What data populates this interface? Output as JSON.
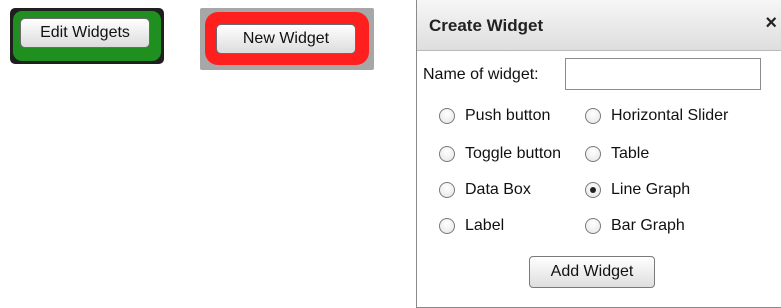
{
  "edit_widgets": {
    "label": "Edit Widgets",
    "frame_color": "#1f8f1f"
  },
  "new_widget": {
    "label": "New Widget",
    "frame_color": "#ff1f1f"
  },
  "dialog": {
    "title": "Create Widget",
    "close_glyph": "×",
    "name_label": "Name of widget:",
    "name_value": "",
    "name_placeholder": "",
    "options": [
      {
        "label": "Push button",
        "checked": false
      },
      {
        "label": "Horizontal Slider",
        "checked": false
      },
      {
        "label": "Toggle button",
        "checked": false
      },
      {
        "label": "Table",
        "checked": false
      },
      {
        "label": "Data Box",
        "checked": false
      },
      {
        "label": "Line Graph",
        "checked": true
      },
      {
        "label": "Label",
        "checked": false
      },
      {
        "label": "Bar Graph",
        "checked": false
      }
    ],
    "add_button_label": "Add Widget"
  }
}
